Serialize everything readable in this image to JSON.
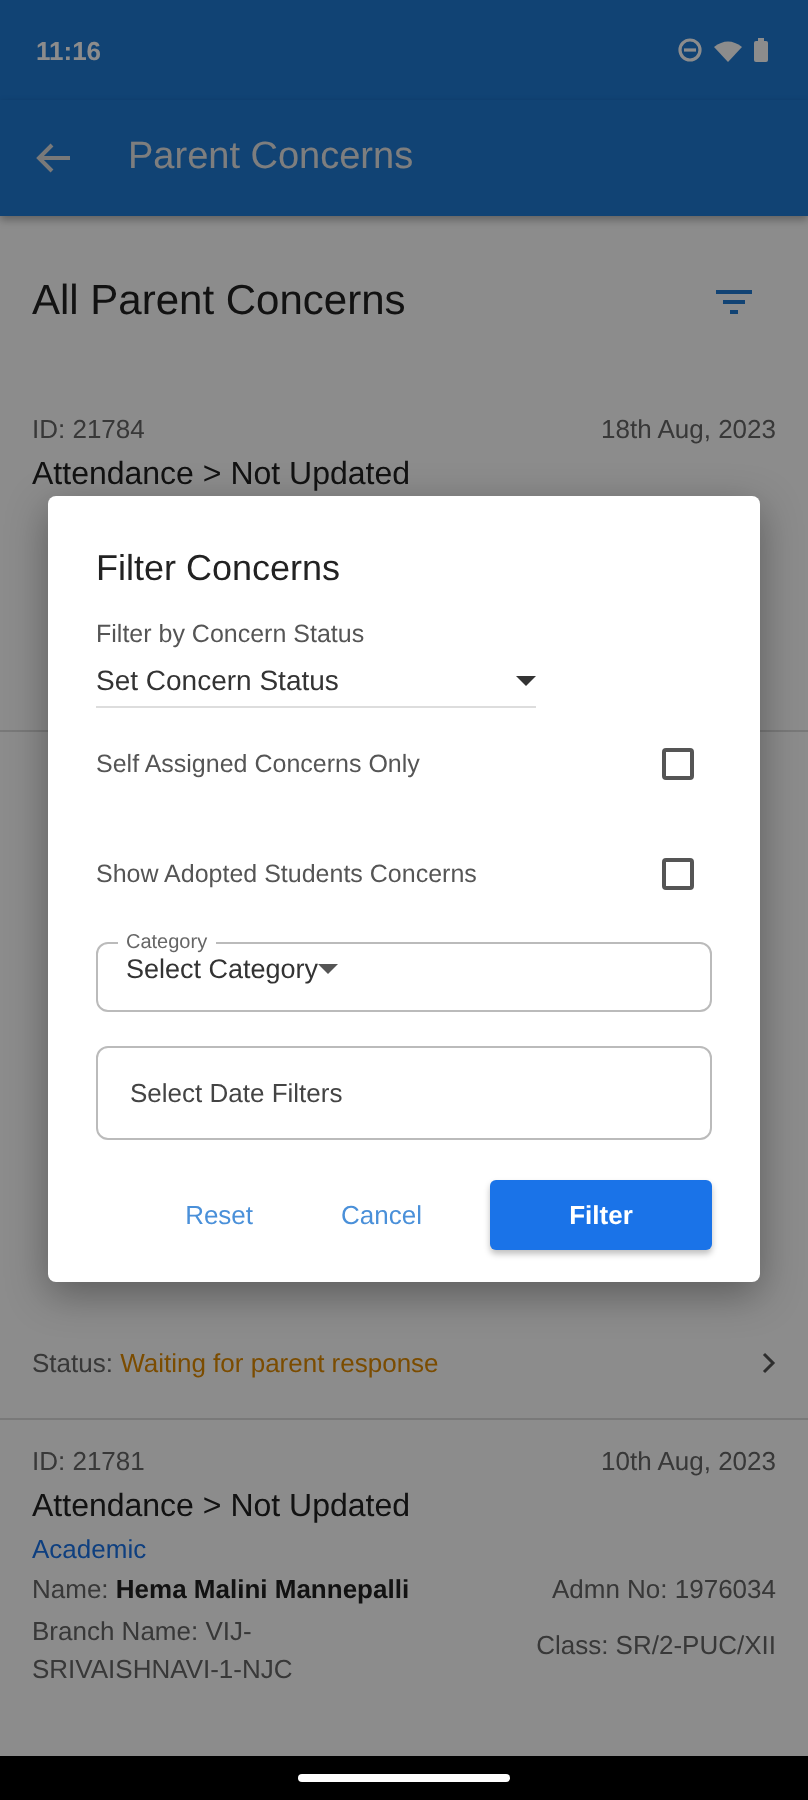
{
  "status_bar": {
    "time": "11:16"
  },
  "app_bar": {
    "title": "Parent Concerns"
  },
  "page": {
    "heading": "All Parent Concerns"
  },
  "concerns": [
    {
      "id": "ID: 21784",
      "date": "18th Aug, 2023",
      "title": "Attendance > Not Updated"
    },
    {
      "status_label": "Status:",
      "status": "Waiting for parent response"
    },
    {
      "id": "ID: 21781",
      "date": "10th Aug, 2023",
      "title": "Attendance > Not Updated",
      "category": "Academic",
      "name_label": "Name:",
      "name": "Hema Malini Mannepalli",
      "admn": "Admn No: 1976034",
      "branch": "Branch Name: VIJ-SRIVAISHNAVI-1-NJC",
      "class": "Class: SR/2-PUC/XII"
    }
  ],
  "dialog": {
    "title": "Filter Concerns",
    "status_label": "Filter by Concern Status",
    "status_value": "Set Concern Status",
    "options": [
      {
        "label": "Self Assigned Concerns Only",
        "checked": false
      },
      {
        "label": "Show Adopted Students Concerns",
        "checked": false
      }
    ],
    "category": {
      "label": "Category",
      "value": "Select Category"
    },
    "date_filter": {
      "placeholder": "Select Date Filters"
    },
    "buttons": [
      {
        "label": "Reset",
        "kind": "text"
      },
      {
        "label": "Cancel",
        "kind": "text"
      },
      {
        "label": "Filter",
        "kind": "filled"
      }
    ]
  }
}
